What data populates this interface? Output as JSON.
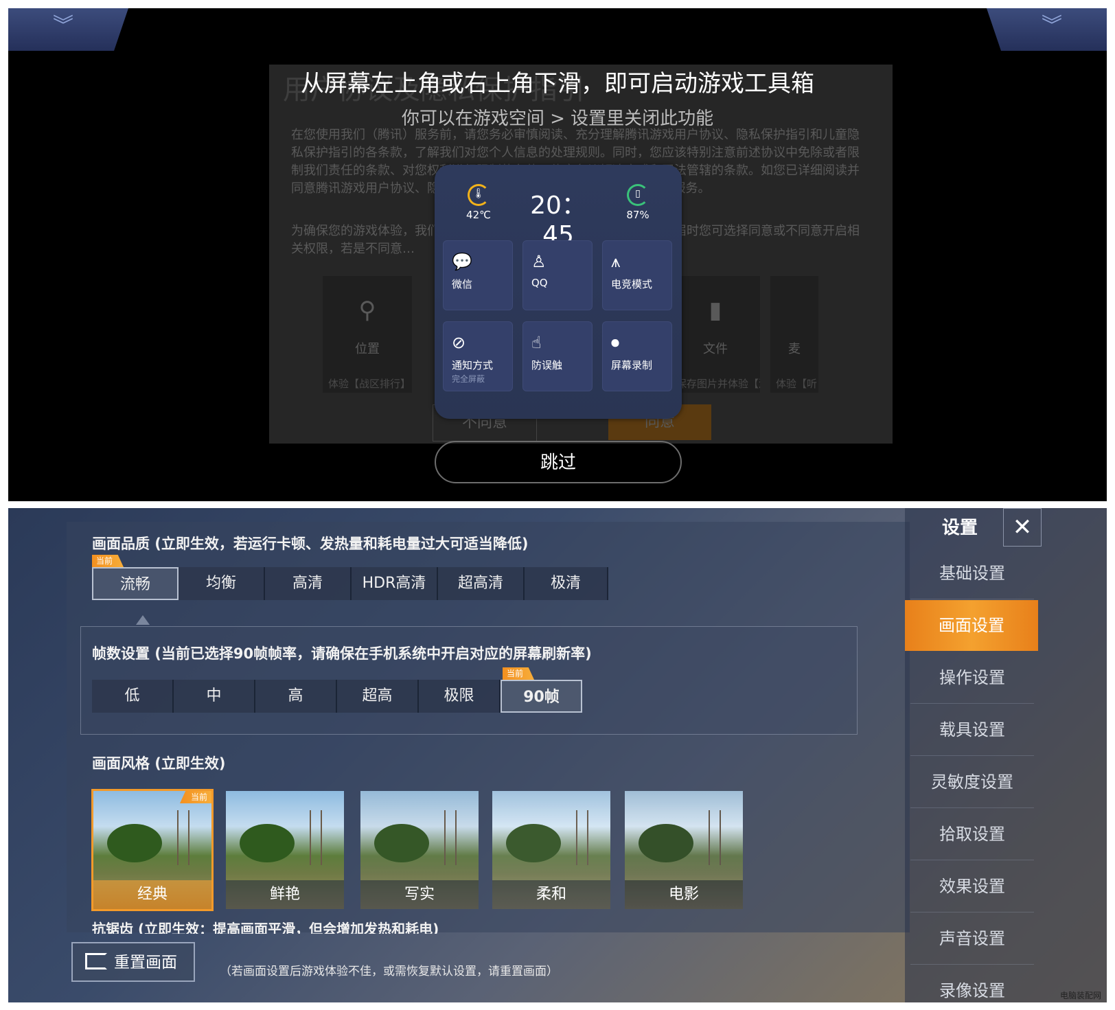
{
  "top": {
    "background_dialog": {
      "watermark_title": "用户协议及隐私保护指引",
      "paragraph1": "在您使用我们（腾讯）服务前，请您务必审慎阅读、充分理解腾讯游戏用户协议、隐私保护指引和儿童隐私保护指引的各条款，了解我们对您个人信息的处理规则。同时，您应该特别注意前述协议中免除或者限制我们责任的条款、对您权利进行限制的条款、约定争议解决方式和司法管辖的条款。如您已详细阅读并同意腾讯游戏用户协议、隐私保护指引，请点击\"同意\"开始使用我们的服务。",
      "paragraph2": "为确保您的游戏体验，我们会在您使用具体功能时向您申请以下权限，届时您可选择同意或不同意开启相关权限，若是不同意…",
      "permissions": [
        {
          "icon": "location-icon",
          "label": "位置",
          "sub": "体验【战区排行】"
        },
        {
          "icon": "file-icon",
          "label": "文件",
          "sub": "保存图片并体验【游"
        },
        {
          "icon": "mic-icon",
          "label": "麦",
          "sub": "体验【听"
        }
      ],
      "disagree_label": "不同意",
      "agree_label": "同意"
    },
    "hint_title": "从屏幕左上角或右上角下滑，即可启动游戏工具箱",
    "hint_sub": "你可以在游戏空间 > 设置里关闭此功能",
    "toolbox": {
      "temperature": "42℃",
      "time": "20：45",
      "battery": "87%",
      "tiles": [
        {
          "icon": "wechat-icon",
          "label": "微信",
          "sub": ""
        },
        {
          "icon": "qq-icon",
          "label": "QQ",
          "sub": ""
        },
        {
          "icon": "esports-icon",
          "label": "电竞模式",
          "sub": ""
        },
        {
          "icon": "notification-icon",
          "label": "通知方式",
          "sub": "完全屏蔽"
        },
        {
          "icon": "anti-touch-icon",
          "label": "防误触",
          "sub": ""
        },
        {
          "icon": "screen-record-icon",
          "label": "屏幕录制",
          "sub": ""
        }
      ]
    },
    "skip_label": "跳过"
  },
  "bottom": {
    "quality": {
      "title": "画面品质 (立即生效，若运行卡顿、发热量和耗电量过大可适当降低)",
      "current_tag": "当前",
      "options": [
        "流畅",
        "均衡",
        "高清",
        "HDR高清",
        "超高清",
        "极清"
      ],
      "selected": "流畅"
    },
    "fps": {
      "title": "帧数设置 (当前已选择90帧帧率，请确保在手机系统中开启对应的屏幕刷新率)",
      "current_tag": "当前",
      "options": [
        "低",
        "中",
        "高",
        "超高",
        "极限",
        "90帧"
      ],
      "selected": "90帧"
    },
    "style": {
      "title": "画面风格 (立即生效)",
      "current_tag": "当前",
      "options": [
        "经典",
        "鲜艳",
        "写实",
        "柔和",
        "电影"
      ],
      "selected": "经典"
    },
    "antialias_cut": "抗锯齿 (立即生效：提高画面平滑，但会增加发热和耗电)",
    "reset_label": "重置画面",
    "reset_note": "（若画面设置后游戏体验不佳，或需恢复默认设置，请重置画面）",
    "sidebar": {
      "title": "设置",
      "close": "✕",
      "items": [
        "基础设置",
        "画面设置",
        "操作设置",
        "载具设置",
        "灵敏度设置",
        "拾取设置",
        "效果设置",
        "声音设置",
        "录像设置"
      ],
      "selected": "画面设置"
    },
    "watermark": "电脑装配网"
  },
  "colors": {
    "accent_orange": "#f39020",
    "toolbox_bg": "#2e3a5c",
    "temp_ring": "#f2b21a",
    "battery_ring": "#3ac27a"
  }
}
